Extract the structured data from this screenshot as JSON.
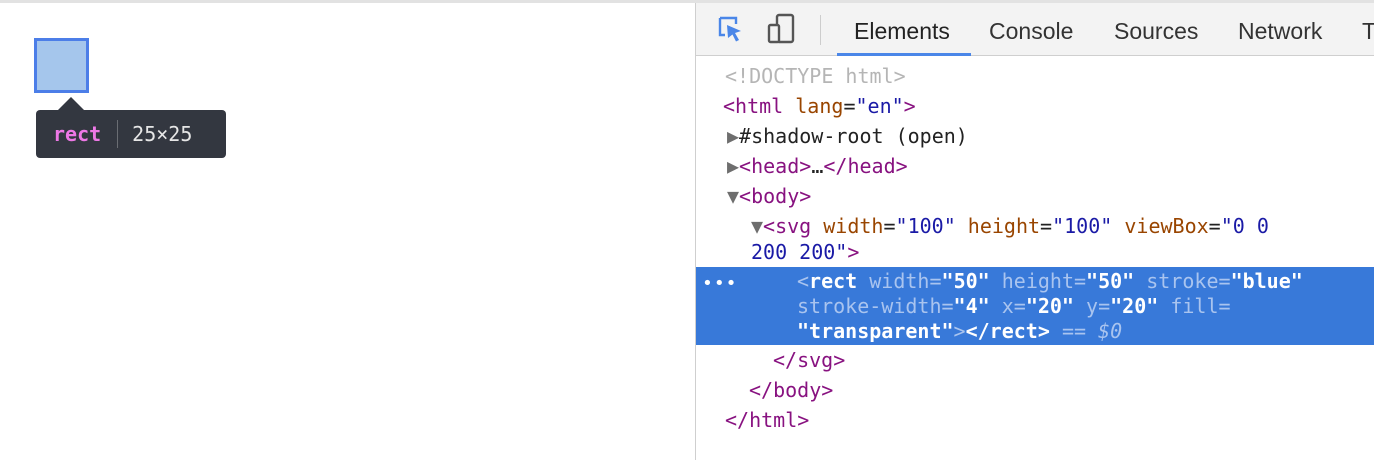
{
  "tooltip": {
    "tag": "rect",
    "dims": "25×25"
  },
  "devtools": {
    "tabs": [
      "Elements",
      "Console",
      "Sources",
      "Network",
      "T"
    ],
    "active_tab": "Elements",
    "tree": {
      "doctype": "<!DOCTYPE html>",
      "html_open": {
        "tag": "html",
        "attr": "lang",
        "value": "\"en\""
      },
      "shadow_root": "#shadow-root (open)",
      "head": {
        "open": "head",
        "ellipsis": "…",
        "close": "/head"
      },
      "body_open": "body",
      "svg": {
        "tag": "svg",
        "attrs": [
          {
            "name": "width",
            "value": "\"100\""
          },
          {
            "name": "height",
            "value": "\"100\""
          },
          {
            "name": "viewBox",
            "value": "\"0 0"
          }
        ],
        "wrap": "200 200\""
      },
      "rect": {
        "tag": "rect",
        "attrs_line1": [
          {
            "name": "width",
            "value": "\"50\""
          },
          {
            "name": "height",
            "value": "\"50\""
          },
          {
            "name": "stroke",
            "value": "\"blue\""
          }
        ],
        "attrs_line2": [
          {
            "name": "stroke-width",
            "value": "\"4\""
          },
          {
            "name": "x",
            "value": "\"20\""
          },
          {
            "name": "y",
            "value": "\"20\""
          },
          {
            "name": "fill",
            "value": ""
          }
        ],
        "line3_value": "\"transparent\"",
        "close": "</rect>",
        "eq": "== $0",
        "dots": "•••"
      },
      "svg_close": "</svg>",
      "body_close": "</body>",
      "html_close": "</html>"
    }
  },
  "colors": {
    "selection": "#3879d9",
    "highlight_fill": "#a5c6ec",
    "highlight_border": "#4c7ee8",
    "tag": "#881280",
    "attr": "#994500",
    "value": "#1a1aa6"
  }
}
